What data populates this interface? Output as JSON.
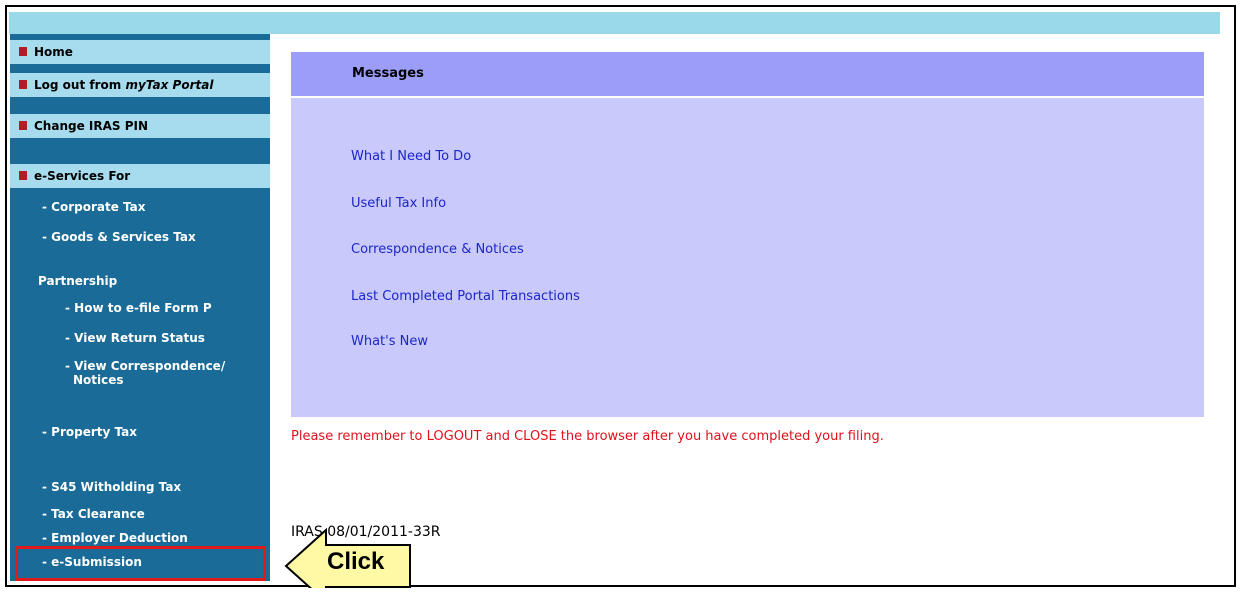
{
  "sidebar": {
    "top_items": [
      {
        "label": "Home",
        "italic": ""
      },
      {
        "label": "Log out from ",
        "italic": "myTax Portal"
      },
      {
        "label": "Change IRAS PIN",
        "italic": ""
      },
      {
        "label": "e-Services For",
        "italic": ""
      }
    ],
    "links": {
      "corporate_tax": "- Corporate Tax",
      "gst": "- Goods & Services Tax",
      "partnership_heading": "Partnership",
      "efile_form_p": "- How to e-file Form P",
      "view_return_status": "- View Return Status",
      "view_correspondence_line1": "- View Correspondence/",
      "view_correspondence_line2": "Notices",
      "property_tax": "- Property Tax",
      "s45_withholding": "- S45 Witholding Tax",
      "tax_clearance": "- Tax Clearance",
      "employer_deduction": "- Employer Deduction",
      "e_submission": "- e-Submission"
    }
  },
  "main": {
    "title": "Messages",
    "links": [
      "What I Need To Do",
      "Useful Tax Info",
      "Correspondence & Notices",
      "Last Completed Portal Transactions",
      "What's New"
    ],
    "logout_notice": "Please remember to LOGOUT and CLOSE the browser after you have completed your filing.",
    "reference": "IRAS 08/01/2011-33R"
  },
  "annotation": {
    "callout_label": "Click"
  },
  "colors": {
    "topbar": "#9ad9ea",
    "sidebar": "#1a6b97",
    "sidebar_top_item": "#a6dcee",
    "bullet": "#b01e23",
    "panel": "#c9c9fb",
    "panel_header": "#9c9cf9",
    "link": "#1c26c8",
    "notice": "#e0111c",
    "callout_fill": "#fff9a6",
    "highlight_border": "#e01a1a"
  }
}
